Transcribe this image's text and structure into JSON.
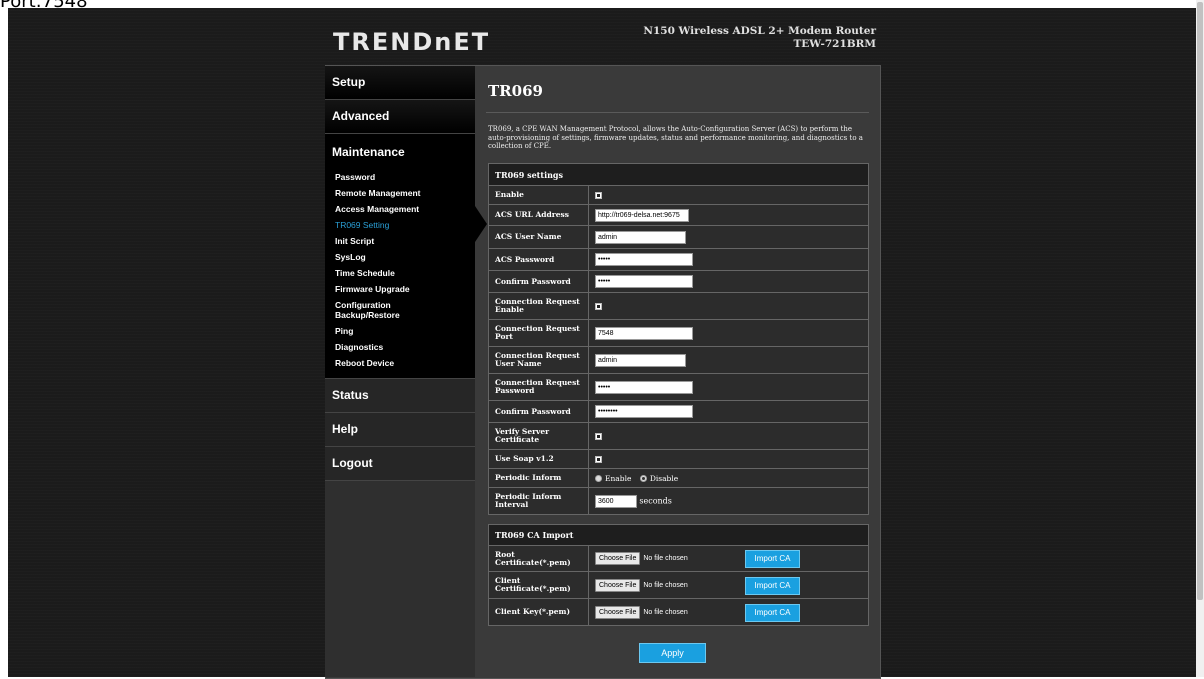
{
  "caption": "Port:7548",
  "header": {
    "logo": "TRENDnET",
    "model_line1": "N150 Wireless ADSL 2+ Modem Router",
    "model_line2": "TEW-721BRM"
  },
  "sidebar": {
    "setup": "Setup",
    "advanced": "Advanced",
    "maintenance": "Maintenance",
    "sub_items": [
      "Password",
      "Remote Management",
      "Access Management",
      "TR069 Setting",
      "Init Script",
      "SysLog",
      "Time Schedule",
      "Firmware Upgrade",
      "Configuration Backup/Restore",
      "Ping",
      "Diagnostics",
      "Reboot Device"
    ],
    "active_item": "TR069 Setting",
    "status": "Status",
    "help": "Help",
    "logout": "Logout"
  },
  "main": {
    "title": "TR069",
    "description": "TR069, a CPE WAN Management Protocol, allows the Auto-Configuration Server (ACS) to perform the auto-provisioning of settings, firmware updates, status and performance monitoring, and diagnostics to a collection of CPE."
  },
  "settings": {
    "header": "TR069 settings",
    "enable_label": "Enable",
    "enable_checked": true,
    "acs_url_label": "ACS URL Address",
    "acs_url_value": "http://tr069-delsa.net:9675",
    "acs_user_label": "ACS User Name",
    "acs_user_value": "admin",
    "acs_password_label": "ACS Password",
    "acs_password_value": "•••••",
    "confirm_password_label": "Confirm Password",
    "confirm_password_value": "•••••",
    "conn_req_enable_label": "Connection Request Enable",
    "conn_req_enable_checked": true,
    "conn_req_port_label": "Connection Request Port",
    "conn_req_port_value": "7548",
    "conn_req_user_label": "Connection Request User Name",
    "conn_req_user_value": "admin",
    "conn_req_password_label": "Connection Request Password",
    "conn_req_password_value": "•••••",
    "confirm_password2_label": "Confirm Password",
    "confirm_password2_value": "••••••••",
    "verify_cert_label": "Verify Server Certificate",
    "verify_cert_checked": true,
    "use_soap_label": "Use Soap v1.2",
    "use_soap_checked": true,
    "periodic_inform_label": "Periodic Inform",
    "periodic_enable": "Enable",
    "periodic_disable": "Disable",
    "periodic_selected": "Disable",
    "periodic_interval_label": "Periodic Inform Interval",
    "periodic_interval_value": "3600",
    "periodic_interval_unit": "seconds"
  },
  "ca_import": {
    "header": "TR069 CA Import",
    "rows": [
      {
        "label": "Root Certificate(*.pem)"
      },
      {
        "label": "Client Certificate(*.pem)"
      },
      {
        "label": "Client Key(*.pem)"
      }
    ],
    "choose_file": "Choose File",
    "no_file": "No file chosen",
    "import_label": "Import CA"
  },
  "apply_label": "Apply"
}
